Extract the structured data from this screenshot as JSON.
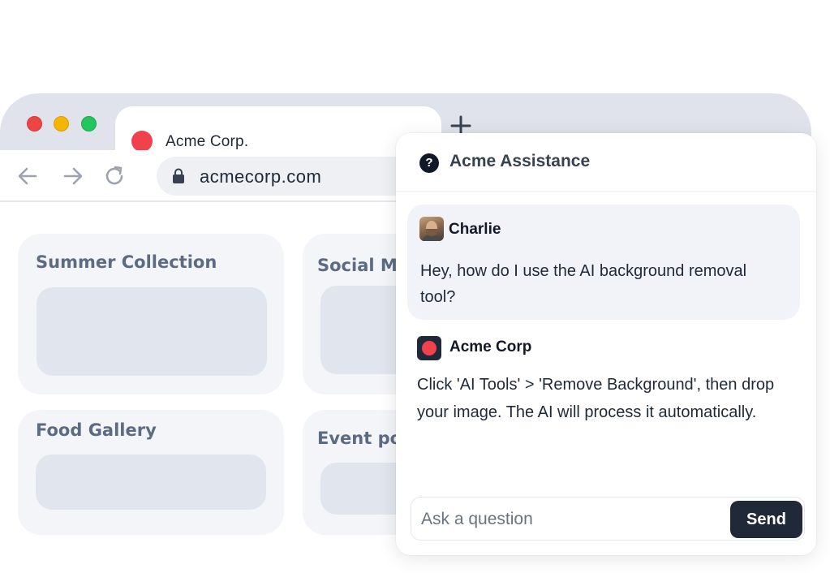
{
  "browser": {
    "tab": {
      "title": "Acme Corp.",
      "favicon_color": "#f0414c"
    },
    "window_controls": [
      "close",
      "minimize",
      "maximize"
    ],
    "address": "acmecorp.com"
  },
  "page": {
    "cards": [
      {
        "title": "Summer Collection"
      },
      {
        "title": "Social Me"
      },
      {
        "title": "Food Gallery"
      },
      {
        "title": "Event pos"
      }
    ]
  },
  "chat": {
    "title": "Acme Assistance",
    "user": {
      "name": "Charlie",
      "message": "Hey, how do I use the AI background removal tool?"
    },
    "bot": {
      "name": "Acme Corp",
      "message": "Click 'AI Tools' > 'Remove Background', then drop your image. The AI will process it automatically."
    },
    "input_placeholder": "Ask a question",
    "send_label": "Send"
  },
  "colors": {
    "brand_red": "#f0414c",
    "dark": "#1f2937",
    "card_bg": "#f4f5f9",
    "card_placeholder": "#e1e6ee"
  },
  "icons": [
    "back-arrow-icon",
    "forward-arrow-icon",
    "reload-icon",
    "lock-icon",
    "close-icon",
    "plus-icon",
    "help-icon"
  ]
}
